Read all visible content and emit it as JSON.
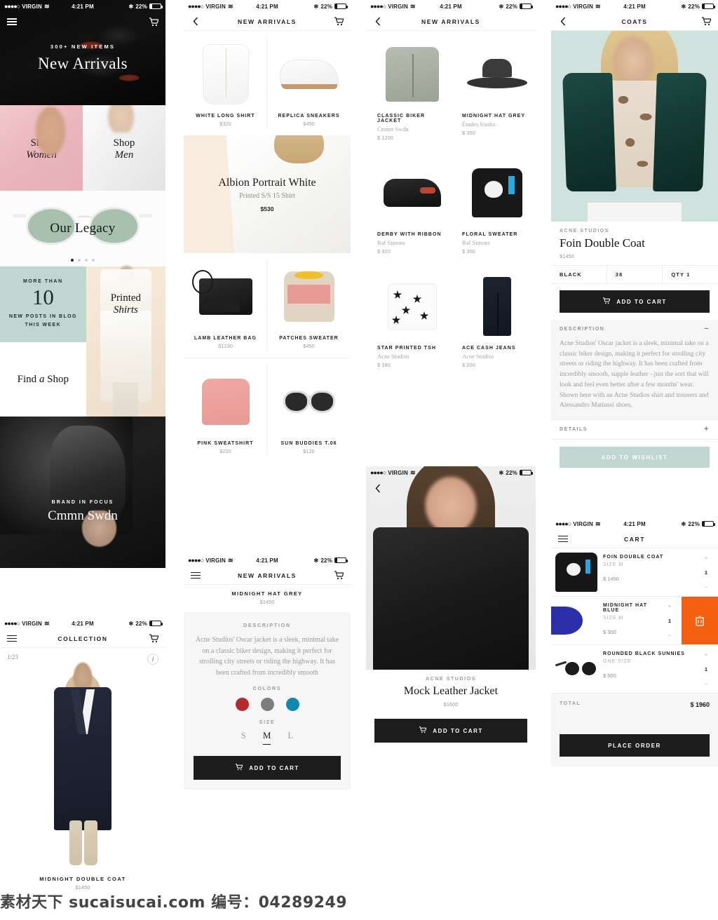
{
  "status_bar": {
    "carrier": "VIRGIN",
    "time": "4:21 PM",
    "battery": "22%",
    "signal_dots": "●●●●○",
    "wifi": "((•))",
    "bt": "✻"
  },
  "screen_home": {
    "hero": {
      "kicker": "300+ NEW ITEMS",
      "title": "New Arrivals",
      "menu_icon": "hamburger-icon",
      "cart_icon": "cart-icon"
    },
    "split": [
      {
        "line1": "Shop",
        "line2": "Women"
      },
      {
        "line1": "Shop",
        "line2": "Men"
      }
    ],
    "legacy": {
      "title": "Our Legacy",
      "pager_active": 1,
      "pager_count": 4
    },
    "blog": {
      "t1": "MORE THAN",
      "number": "10",
      "t2a": "NEW POSTS IN BLOG",
      "t2b": "THIS WEEK"
    },
    "printed": {
      "line1": "Printed",
      "line2": "Shirts"
    },
    "find_shop": {
      "a": "Find",
      "b": "a",
      "c": "Shop"
    },
    "brand_focus": {
      "kicker": "BRAND IN FOCUS",
      "title": "Cmmn Swdn"
    }
  },
  "screen_collection": {
    "nav_title": "COLLECTION",
    "counter": "1/23",
    "info_icon": "i",
    "product_name": "MIDNIGHT DOUBLE COAT",
    "product_price": "$1450"
  },
  "screen_new_arrivals_a": {
    "nav_title": "NEW ARRIVALS",
    "back_icon": "chevron-left-icon",
    "cart_icon": "cart-icon",
    "products": [
      {
        "name": "WHITE LONG SHIRT",
        "price": "$320",
        "art": "shirt"
      },
      {
        "name": "REPLICA SNEAKERS",
        "price": "$450",
        "art": "sneaker"
      },
      {
        "name": "LAMB LEATHER BAG",
        "price": "$1230",
        "art": "bag"
      },
      {
        "name": "PATCHES SWEATER",
        "price": "$450",
        "art": "patch"
      },
      {
        "name": "PINK SWEATSHIRT",
        "price": "$220",
        "art": "pink"
      },
      {
        "name": "SUN BUDDIES T.06",
        "price": "$120",
        "art": "sun"
      }
    ],
    "promo": {
      "title": "Albion Portrait White",
      "subtitle": "Printed S/S 15 Shirt",
      "price": "$530"
    }
  },
  "screen_product_detail_a": {
    "nav_title": "NEW ARRIVALS",
    "menu_icon": "hamburger-icon",
    "product_name": "MIDNIGHT HAT GREY",
    "product_price": "$1450",
    "description_label": "DESCRIPTION",
    "description": "Acne Studios' Oscar jacket is a sleek, minimal take on a classic biker design, making it perfect for strolling city streets or riding the highway. It has been crafted from incredibly smooth",
    "colors_label": "COLORS",
    "colors": [
      "#b62a2f",
      "#7d7d7d",
      "#1287b0"
    ],
    "size_label": "SIZE",
    "sizes": [
      "S",
      "M",
      "L"
    ],
    "selected_size": "M",
    "add_to_cart": "ADD TO CART"
  },
  "screen_new_arrivals_b": {
    "nav_title": "NEW ARRIVALS",
    "back_icon": "chevron-left-icon",
    "products": [
      {
        "name": "CLASSIC BIKER JACKET",
        "brand": "Cmmn Swdn",
        "price": "$ 1200",
        "art": "biker"
      },
      {
        "name": "MIDNIGHT HAT GREY",
        "brand": "Études Studio",
        "price": "$ 350",
        "art": "hat"
      },
      {
        "name": "DERBY WITH RIBBON",
        "brand": "Raf Simons",
        "price": "$ 920",
        "art": "derby"
      },
      {
        "name": "FLORAL SWEATER",
        "brand": "Raf Simons",
        "price": "$ 300",
        "art": "floral"
      },
      {
        "name": "STAR PRINTED TSH",
        "brand": "Acne Studios",
        "price": "$ 180",
        "art": "star"
      },
      {
        "name": "ACE CASH JEANS",
        "brand": "Acne Studios",
        "price": "$ 200",
        "art": "jeans"
      }
    ]
  },
  "screen_product_detail_b": {
    "brand": "ACNE STUDIOS",
    "title": "Mock Leather Jacket",
    "price": "$1600",
    "add_to_cart": "ADD TO CART",
    "back_icon": "chevron-left-icon"
  },
  "screen_pdp": {
    "nav_title": "COATS",
    "back_icon": "chevron-left-icon",
    "cart_icon": "cart-icon",
    "brand": "ACNE STUDIOS",
    "title": "Foin Double Coat",
    "price": "$1450",
    "options": [
      "BLACK",
      "38",
      "QTY 1"
    ],
    "add_to_cart": "ADD TO CART",
    "description_label": "DESCRIPTION",
    "description_toggle": "−",
    "description": "Acne Studios' Oscar jacket is a sleek, minimal take on a classic biker design, making it perfect for strolling city streets or riding the highway. It has been crafted from incredibly smooth, supple leather - just the sort that will look and feel even better after a few months' wear. Shown here with an Acne Studios shirt and trousers and Alessandro Matiussi shoes.",
    "details_label": "DETAILS",
    "details_toggle": "+",
    "wishlist": "ADD TO WISHLIST",
    "wishlist_color": "#bfd6d1"
  },
  "screen_cart": {
    "nav_title": "CART",
    "menu_icon": "hamburger-icon",
    "items": [
      {
        "name": "FOIN DOUBLE COAT",
        "size": "SIZE M",
        "price": "$ 1450",
        "qty": "1",
        "plus": "+",
        "minus": "−",
        "art": "sweat",
        "deleting": false
      },
      {
        "name": "MIDNIGHT HAT BLUE",
        "size": "SIZE M",
        "price": "$ 300",
        "qty": "1",
        "plus": "+",
        "minus": "−",
        "art": "hatblue",
        "deleting": true,
        "delete_icon": "trash-icon",
        "delete_color": "#f4600f"
      },
      {
        "name": "ROUNDED BLACK SUNNIES",
        "size": "ONE SIZE",
        "price": "$ 500",
        "qty": "1",
        "plus": "+",
        "minus": "−",
        "art": "sunnies",
        "deleting": false
      }
    ],
    "total_label": "TOTAL",
    "total_value": "$ 1960",
    "place_order": "PLACE ORDER"
  },
  "watermark": {
    "text": "素材天下 sucaisucai.com  编号：04289249"
  }
}
